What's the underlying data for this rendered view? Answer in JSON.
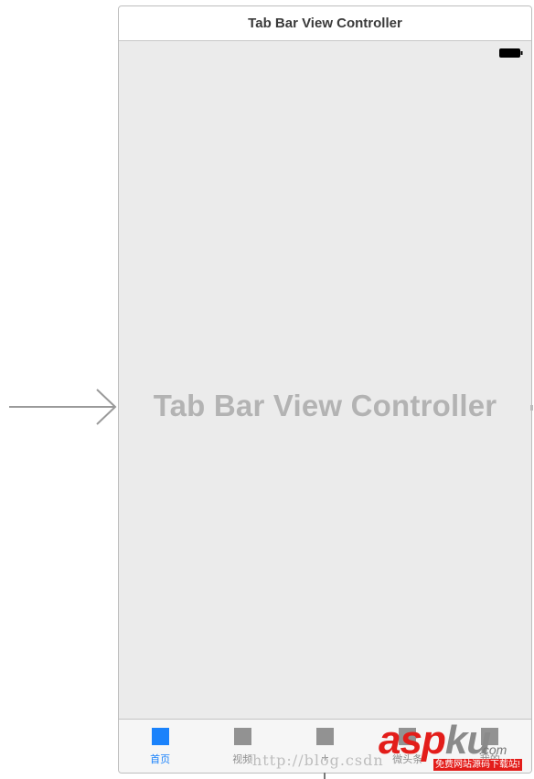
{
  "scene": {
    "header_title": "Tab Bar View Controller",
    "center_title": "Tab Bar View Controller"
  },
  "tab_bar": {
    "items": [
      {
        "label": "首页",
        "selected": true
      },
      {
        "label": "视频",
        "selected": false
      },
      {
        "label": "+",
        "selected": false
      },
      {
        "label": "微头条",
        "selected": false
      },
      {
        "label": "我的",
        "selected": false
      }
    ],
    "selected_color": "#1a82fb",
    "unselected_color": "#8e8e8e"
  },
  "watermark": {
    "url_text": "http://blog.csdn",
    "logo_main_red": "asp",
    "logo_main_gray": "ku",
    "logo_tld": ".com",
    "logo_sub": "免费网站源码下载站!"
  },
  "status_bar": {
    "icon": "battery-icon"
  }
}
